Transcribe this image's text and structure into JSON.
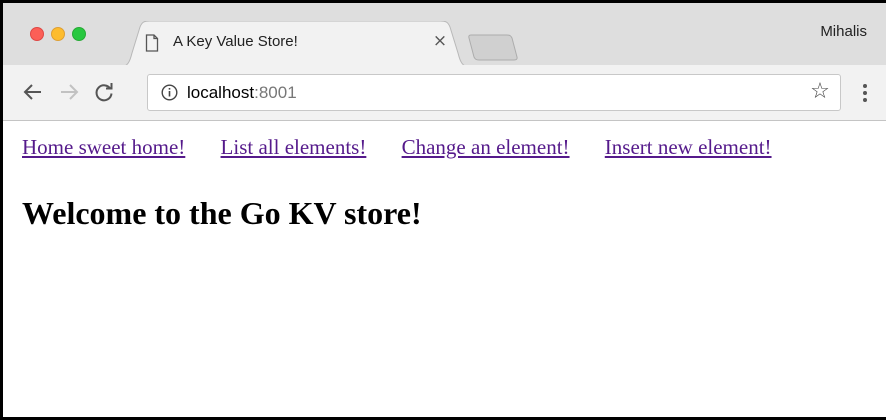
{
  "browser": {
    "tab": {
      "title": "A Key Value Store!",
      "icon": "document-icon",
      "close_glyph": "×"
    },
    "profile_name": "Mihalis",
    "address_bar": {
      "host": "localhost",
      "port": ":8001",
      "security_icon": "info-icon",
      "bookmark_glyph": "☆"
    },
    "toolbar_icons": [
      "back-arrow-icon",
      "forward-arrow-icon",
      "reload-icon",
      "kebab-menu-icon"
    ],
    "window_controls": {
      "close_color": "#fc5f57",
      "minimize_color": "#fdbc2e",
      "maximize_color": "#28c840"
    }
  },
  "page": {
    "nav_links": [
      "Home sweet home!",
      "List all elements!",
      "Change an element!",
      "Insert new element!"
    ],
    "heading": "Welcome to the Go KV store!",
    "link_color": "#551a8b"
  }
}
